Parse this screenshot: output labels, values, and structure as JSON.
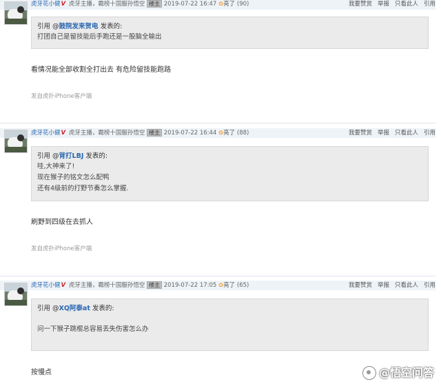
{
  "posts": [
    {
      "user": "虎牙花小健",
      "vip": "V",
      "title": "虎牙主播，霸榜十国服孙悟空",
      "badge": "楼主",
      "time": "2019-07-22 16:47",
      "liang_label": "亮了",
      "liang_count": "(90)",
      "actions": [
        "我要赞赏",
        "举报",
        "只看此人",
        "引用"
      ],
      "quote": {
        "prefix": "引用 @",
        "user": "鼓院发来贺电",
        "suffix": " 发表的:",
        "lines": [
          "打团自己是留技能后手跑还是一股脑全输出"
        ]
      },
      "content": "看情况能全部收割全打出去 有危险留技能跑路",
      "source": "发自虎扑iPhone客户端"
    },
    {
      "user": "虎牙花小健",
      "vip": "V",
      "title": "虎牙主播，霸榜十国服孙悟空",
      "badge": "楼主",
      "time": "2019-07-22 16:44",
      "liang_label": "亮了",
      "liang_count": "(88)",
      "actions": [
        "我要赞赏",
        "举报",
        "只看此人",
        "引用"
      ],
      "quote": {
        "prefix": "引用 @",
        "user": "背打LBJ",
        "suffix": " 发表的:",
        "lines": [
          "哇,大神来了!",
          "现在猴子的铭文怎么配鸭",
          "还有4级前的打野节奏怎么掌握."
        ]
      },
      "content": "刷野到四级在去抓人",
      "source": "发自虎扑iPhone客户端"
    },
    {
      "user": "虎牙花小健",
      "vip": "V",
      "title": "虎牙主播，霸榜十国服孙悟空",
      "badge": "楼主",
      "time": "2019-07-22 17:05",
      "liang_label": "亮了",
      "liang_count": "(65)",
      "actions": [
        "我要赞赏",
        "举报",
        "只看此人",
        "引用"
      ],
      "quote": {
        "prefix": "引用 @",
        "user": "XQ阿泰at",
        "suffix": " 发表的:",
        "lines": [
          "问一下猴子跳棍总容易丢失伤害怎么办"
        ]
      },
      "content": "按慢点",
      "source": ""
    }
  ],
  "watermark": "@悟空问答"
}
